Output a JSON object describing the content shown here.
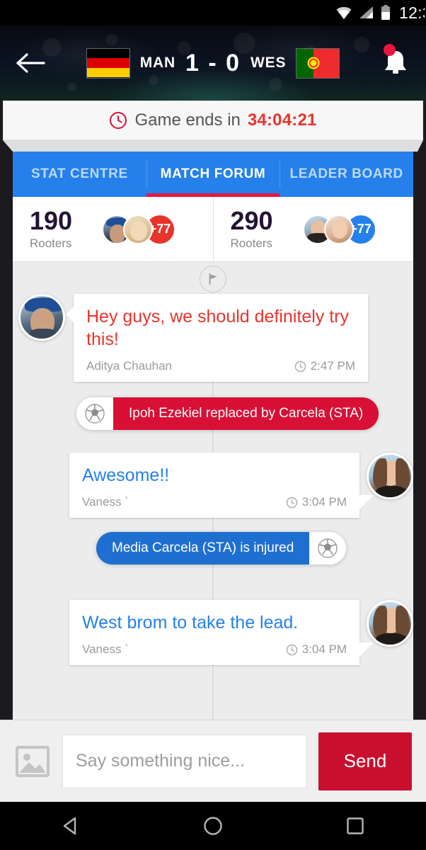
{
  "status_bar": {
    "time": "12:3",
    "icons": [
      "wifi-icon",
      "signal-icon",
      "battery-icon"
    ]
  },
  "header": {
    "back_icon": "back-arrow-icon",
    "home_team": {
      "abbr": "MAN",
      "flag": "germany-flag"
    },
    "away_team": {
      "abbr": "WES",
      "flag": "portugal-flag"
    },
    "score": "1 - 0",
    "notification_icon": "bell-icon",
    "has_notification": true
  },
  "game_bar": {
    "clock_icon": "clock-icon",
    "label": "Game ends in",
    "countdown": "34:04:21",
    "countdown_color": "#e8342b"
  },
  "tabs": [
    {
      "label": "STAT CENTRE",
      "active": false
    },
    {
      "label": "MATCH FORUM",
      "active": true
    },
    {
      "label": "LEADER BOARD",
      "active": false
    }
  ],
  "rooters": [
    {
      "count": "190",
      "label": "Rooters",
      "more": "+77",
      "more_color": "#e8342b"
    },
    {
      "count": "290",
      "label": "Rooters",
      "more": "+77",
      "more_color": "#2580eb"
    }
  ],
  "feed": {
    "timeline_icon": "flag-marker-icon",
    "items": [
      {
        "kind": "message",
        "side": "left",
        "text": "Hey guys, we should definitely try this!",
        "text_color": "#e8342b",
        "author": "Aditya Chauhan",
        "time": "2:47 PM",
        "clock_icon": "clock-icon",
        "avatar": "avatar-man-blue-cap"
      },
      {
        "kind": "event",
        "side": "left",
        "text": "Ipoh Ezekiel replaced by Carcela (STA)",
        "color": "#d81036",
        "ball_icon": "soccer-ball-icon",
        "ball_position": "left"
      },
      {
        "kind": "message",
        "side": "right",
        "text": "Awesome!!",
        "text_color": "#2580eb",
        "author": "Vaness `",
        "time": "3:04 PM",
        "clock_icon": "clock-icon",
        "avatar": "avatar-woman-smiling"
      },
      {
        "kind": "event",
        "side": "right",
        "text": "Media Carcela (STA) is injured",
        "color": "#1f6fd0",
        "ball_icon": "soccer-ball-icon",
        "ball_position": "right"
      },
      {
        "kind": "message",
        "side": "right",
        "text": "West brom to take the lead.",
        "text_color": "#2580eb",
        "author": "Vaness `",
        "time": "3:04 PM",
        "clock_icon": "clock-icon",
        "avatar": "avatar-woman-smiling"
      }
    ]
  },
  "composer": {
    "image_icon": "image-picker-icon",
    "placeholder": "Say something nice...",
    "value": "",
    "send_label": "Send",
    "send_color": "#c8102e"
  },
  "nav_bar": {
    "back": "nav-back-icon",
    "home": "nav-home-icon",
    "recents": "nav-recents-icon"
  }
}
